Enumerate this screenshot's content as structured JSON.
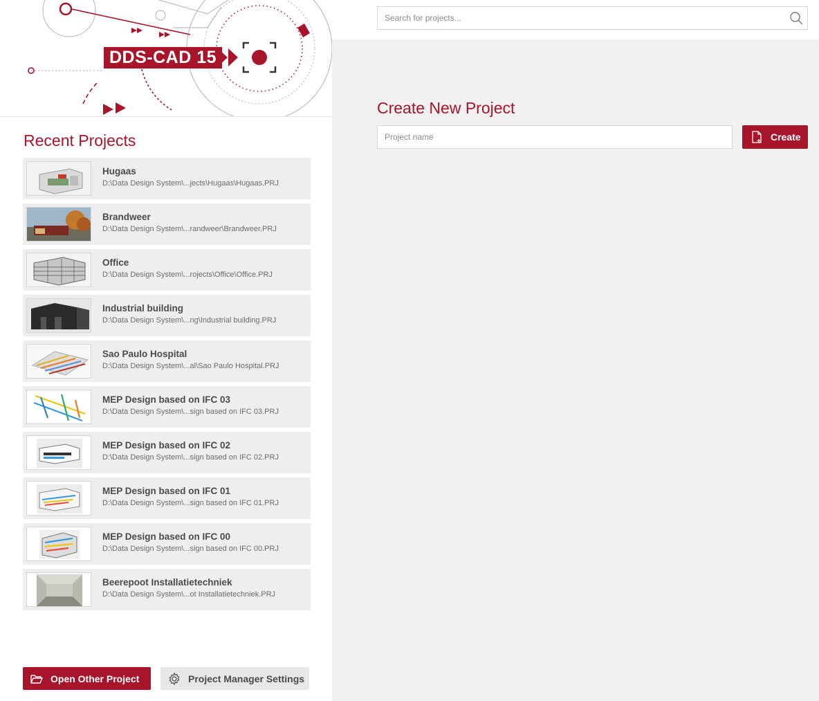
{
  "brand": {
    "logo_text": "DDS-CAD 15",
    "accent": "#a8152b"
  },
  "recent": {
    "title": "Recent Projects",
    "projects": [
      {
        "name": "Hugaas",
        "path": "D:\\Data Design System\\...jects\\Hugaas\\Hugaas.PRJ"
      },
      {
        "name": "Brandweer",
        "path": "D:\\Data Design System\\...randweer\\Brandweer.PRJ"
      },
      {
        "name": "Office",
        "path": "D:\\Data Design System\\...rojects\\Office\\Office.PRJ"
      },
      {
        "name": "Industrial building",
        "path": "D:\\Data Design System\\...ng\\Industrial building.PRJ"
      },
      {
        "name": "Sao Paulo Hospital",
        "path": "D:\\Data Design System\\...al\\Sao Paulo Hospital.PRJ"
      },
      {
        "name": "MEP  Design based on IFC 03",
        "path": "D:\\Data Design System\\...sign based on IFC 03.PRJ"
      },
      {
        "name": "MEP  Design based on IFC 02",
        "path": "D:\\Data Design System\\...sign based on IFC 02.PRJ"
      },
      {
        "name": "MEP  Design based on IFC 01",
        "path": "D:\\Data Design System\\...sign based on IFC 01.PRJ"
      },
      {
        "name": "MEP  Design based on IFC 00",
        "path": "D:\\Data Design System\\...sign based on IFC 00.PRJ"
      },
      {
        "name": "Beerepoot Installatietechniek",
        "path": "D:\\Data Design System\\...ot Installatietechniek.PRJ"
      }
    ]
  },
  "footer": {
    "open_label": "Open Other Project",
    "open_icon": "folder-open-icon",
    "settings_label": "Project Manager Settings",
    "settings_icon": "gear-icon"
  },
  "search": {
    "placeholder": "Search for projects...",
    "value": "",
    "icon": "search-icon"
  },
  "create": {
    "title": "Create New Project",
    "name_placeholder": "Project name",
    "name_value": "",
    "button_label": "Create",
    "button_icon": "new-document-icon"
  }
}
